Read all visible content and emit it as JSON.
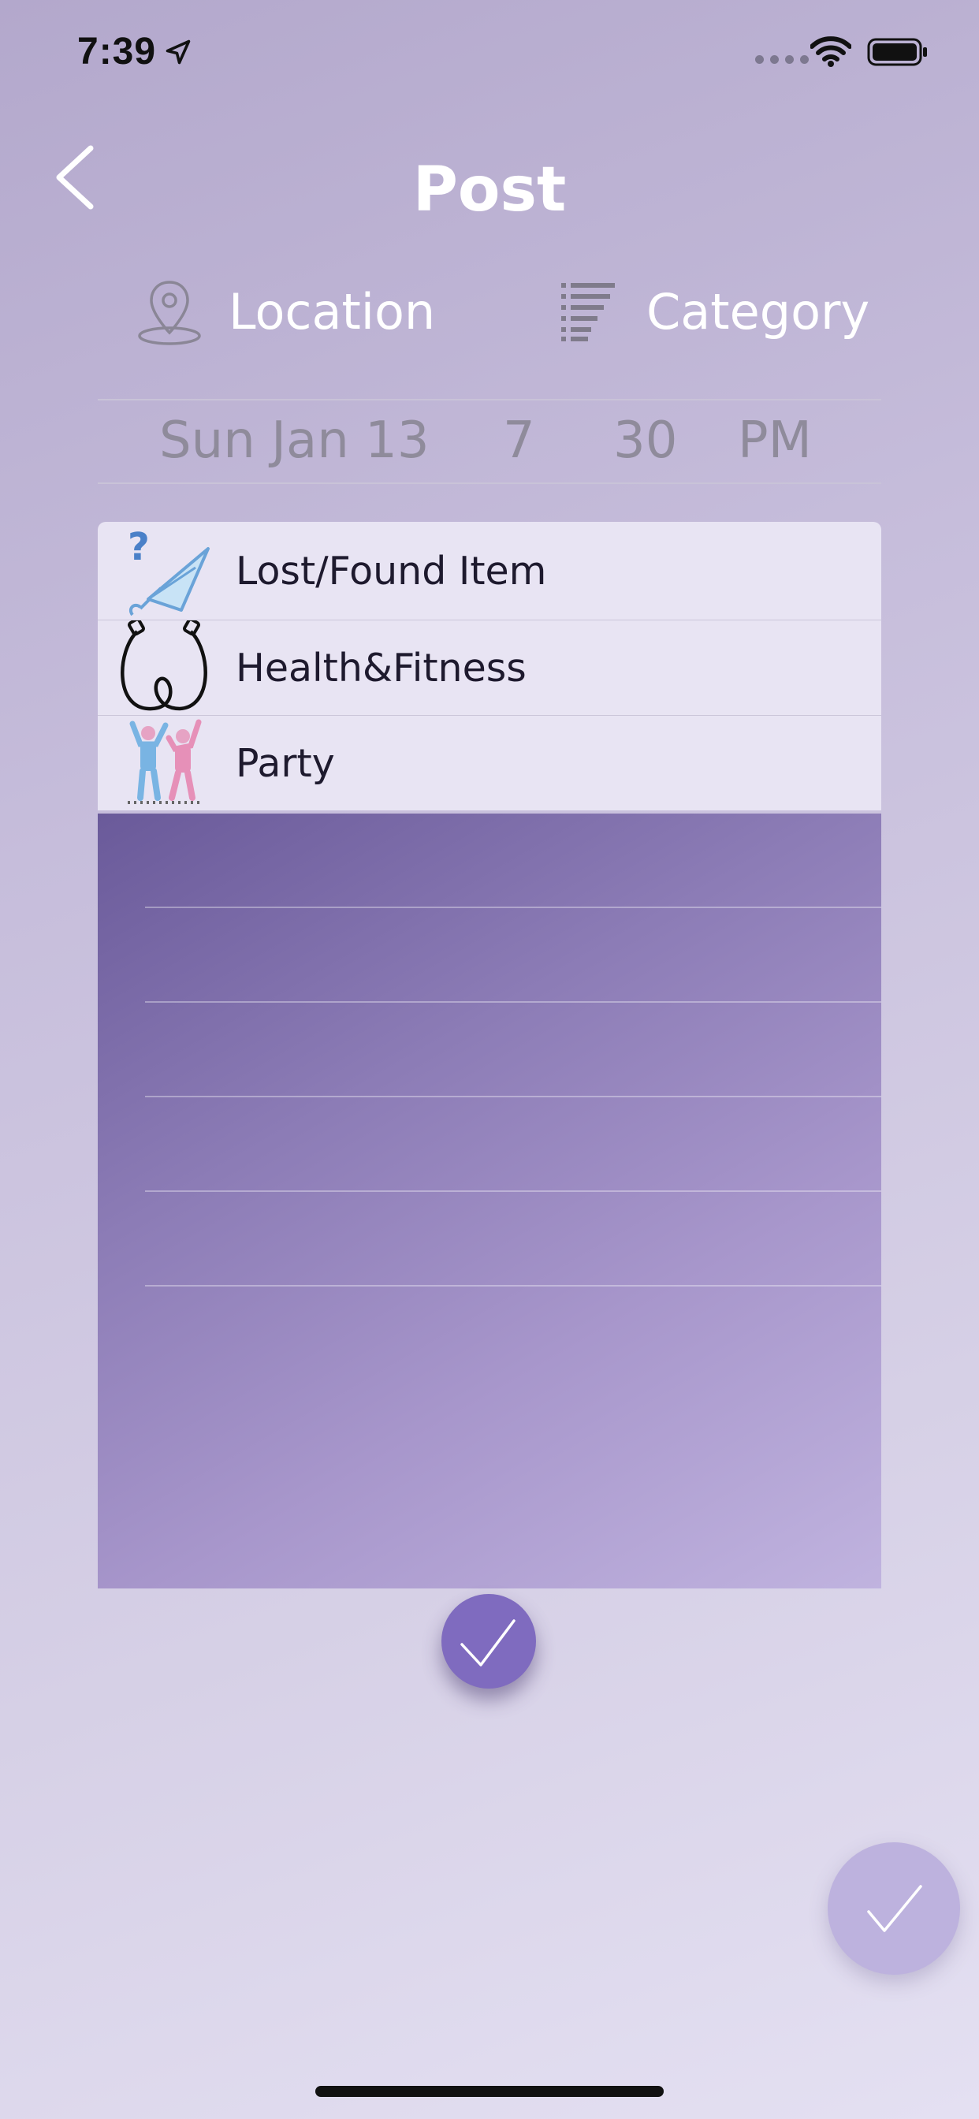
{
  "status_bar": {
    "time": "7:39"
  },
  "header": {
    "title": "Post"
  },
  "options": {
    "location_label": "Location",
    "category_label": "Category"
  },
  "date_picker": {
    "date": "Sun Jan 13",
    "hour": "7",
    "minute": "30",
    "meridiem": "PM"
  },
  "categories": [
    {
      "label": "Lost/Found Item",
      "icon": "umbrella-question-icon"
    },
    {
      "label": "Health&Fitness",
      "icon": "jump-rope-icon"
    },
    {
      "label": "Party",
      "icon": "dancing-people-icon"
    }
  ],
  "colors": {
    "accent": "#7f6bbf",
    "fab": "#bdb2de",
    "dropdown_bg": "#e8e4f3"
  }
}
